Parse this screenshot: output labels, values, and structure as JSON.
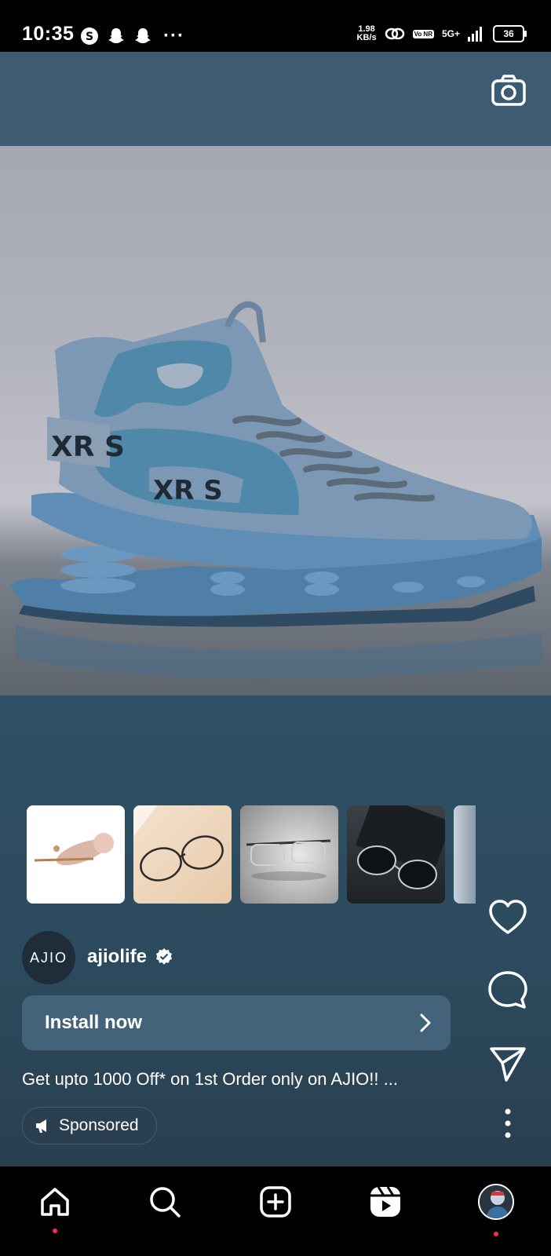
{
  "status_bar": {
    "time": "10:35",
    "network_speed_value": "1.98",
    "network_speed_unit": "KB/s",
    "network_type": "5G+",
    "volte": "Vo NR",
    "battery": "36"
  },
  "ad": {
    "account_logo_text": "AJIO",
    "account_handle": "ajiolife",
    "cta_label": "Install now",
    "caption": "Get upto 1000 Off* on 1st Order only on AJIO!! ...",
    "sponsored_label": "Sponsored"
  },
  "thumbnails": [
    {
      "name": "thumb-rose-gold-accessory"
    },
    {
      "name": "thumb-metal-eyeglasses"
    },
    {
      "name": "thumb-clear-eyeglasses"
    },
    {
      "name": "thumb-sunglasses"
    }
  ],
  "icons": {
    "camera": "camera-icon",
    "like": "heart-icon",
    "comment": "comment-icon",
    "share": "send-icon",
    "more": "more-vertical-icon",
    "home": "home-icon",
    "search": "search-icon",
    "create": "plus-square-icon",
    "reels": "reels-icon",
    "profile": "profile-avatar"
  },
  "colors": {
    "background": "#2f4e62",
    "cta_background": "#43637a",
    "notification_dot": "#ff2b4a"
  }
}
